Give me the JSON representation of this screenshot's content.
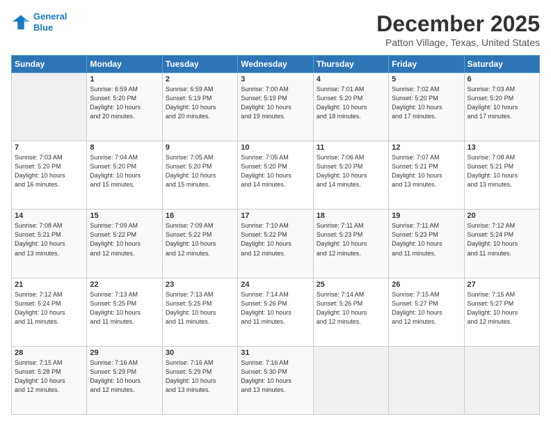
{
  "header": {
    "logo_line1": "General",
    "logo_line2": "Blue",
    "title": "December 2025",
    "subtitle": "Patton Village, Texas, United States"
  },
  "days_of_week": [
    "Sunday",
    "Monday",
    "Tuesday",
    "Wednesday",
    "Thursday",
    "Friday",
    "Saturday"
  ],
  "weeks": [
    [
      {
        "day": "",
        "info": ""
      },
      {
        "day": "1",
        "info": "Sunrise: 6:59 AM\nSunset: 5:20 PM\nDaylight: 10 hours\nand 20 minutes."
      },
      {
        "day": "2",
        "info": "Sunrise: 6:59 AM\nSunset: 5:19 PM\nDaylight: 10 hours\nand 20 minutes."
      },
      {
        "day": "3",
        "info": "Sunrise: 7:00 AM\nSunset: 5:19 PM\nDaylight: 10 hours\nand 19 minutes."
      },
      {
        "day": "4",
        "info": "Sunrise: 7:01 AM\nSunset: 5:20 PM\nDaylight: 10 hours\nand 18 minutes."
      },
      {
        "day": "5",
        "info": "Sunrise: 7:02 AM\nSunset: 5:20 PM\nDaylight: 10 hours\nand 17 minutes."
      },
      {
        "day": "6",
        "info": "Sunrise: 7:03 AM\nSunset: 5:20 PM\nDaylight: 10 hours\nand 17 minutes."
      }
    ],
    [
      {
        "day": "7",
        "info": "Sunrise: 7:03 AM\nSunset: 5:20 PM\nDaylight: 10 hours\nand 16 minutes."
      },
      {
        "day": "8",
        "info": "Sunrise: 7:04 AM\nSunset: 5:20 PM\nDaylight: 10 hours\nand 15 minutes."
      },
      {
        "day": "9",
        "info": "Sunrise: 7:05 AM\nSunset: 5:20 PM\nDaylight: 10 hours\nand 15 minutes."
      },
      {
        "day": "10",
        "info": "Sunrise: 7:05 AM\nSunset: 5:20 PM\nDaylight: 10 hours\nand 14 minutes."
      },
      {
        "day": "11",
        "info": "Sunrise: 7:06 AM\nSunset: 5:20 PM\nDaylight: 10 hours\nand 14 minutes."
      },
      {
        "day": "12",
        "info": "Sunrise: 7:07 AM\nSunset: 5:21 PM\nDaylight: 10 hours\nand 13 minutes."
      },
      {
        "day": "13",
        "info": "Sunrise: 7:08 AM\nSunset: 5:21 PM\nDaylight: 10 hours\nand 13 minutes."
      }
    ],
    [
      {
        "day": "14",
        "info": "Sunrise: 7:08 AM\nSunset: 5:21 PM\nDaylight: 10 hours\nand 13 minutes."
      },
      {
        "day": "15",
        "info": "Sunrise: 7:09 AM\nSunset: 5:22 PM\nDaylight: 10 hours\nand 12 minutes."
      },
      {
        "day": "16",
        "info": "Sunrise: 7:09 AM\nSunset: 5:22 PM\nDaylight: 10 hours\nand 12 minutes."
      },
      {
        "day": "17",
        "info": "Sunrise: 7:10 AM\nSunset: 5:22 PM\nDaylight: 10 hours\nand 12 minutes."
      },
      {
        "day": "18",
        "info": "Sunrise: 7:11 AM\nSunset: 5:23 PM\nDaylight: 10 hours\nand 12 minutes."
      },
      {
        "day": "19",
        "info": "Sunrise: 7:11 AM\nSunset: 5:23 PM\nDaylight: 10 hours\nand 11 minutes."
      },
      {
        "day": "20",
        "info": "Sunrise: 7:12 AM\nSunset: 5:24 PM\nDaylight: 10 hours\nand 11 minutes."
      }
    ],
    [
      {
        "day": "21",
        "info": "Sunrise: 7:12 AM\nSunset: 5:24 PM\nDaylight: 10 hours\nand 11 minutes."
      },
      {
        "day": "22",
        "info": "Sunrise: 7:13 AM\nSunset: 5:25 PM\nDaylight: 10 hours\nand 11 minutes."
      },
      {
        "day": "23",
        "info": "Sunrise: 7:13 AM\nSunset: 5:25 PM\nDaylight: 10 hours\nand 11 minutes."
      },
      {
        "day": "24",
        "info": "Sunrise: 7:14 AM\nSunset: 5:26 PM\nDaylight: 10 hours\nand 11 minutes."
      },
      {
        "day": "25",
        "info": "Sunrise: 7:14 AM\nSunset: 5:26 PM\nDaylight: 10 hours\nand 12 minutes."
      },
      {
        "day": "26",
        "info": "Sunrise: 7:15 AM\nSunset: 5:27 PM\nDaylight: 10 hours\nand 12 minutes."
      },
      {
        "day": "27",
        "info": "Sunrise: 7:15 AM\nSunset: 5:27 PM\nDaylight: 10 hours\nand 12 minutes."
      }
    ],
    [
      {
        "day": "28",
        "info": "Sunrise: 7:15 AM\nSunset: 5:28 PM\nDaylight: 10 hours\nand 12 minutes."
      },
      {
        "day": "29",
        "info": "Sunrise: 7:16 AM\nSunset: 5:29 PM\nDaylight: 10 hours\nand 12 minutes."
      },
      {
        "day": "30",
        "info": "Sunrise: 7:16 AM\nSunset: 5:29 PM\nDaylight: 10 hours\nand 13 minutes."
      },
      {
        "day": "31",
        "info": "Sunrise: 7:16 AM\nSunset: 5:30 PM\nDaylight: 10 hours\nand 13 minutes."
      },
      {
        "day": "",
        "info": ""
      },
      {
        "day": "",
        "info": ""
      },
      {
        "day": "",
        "info": ""
      }
    ]
  ]
}
